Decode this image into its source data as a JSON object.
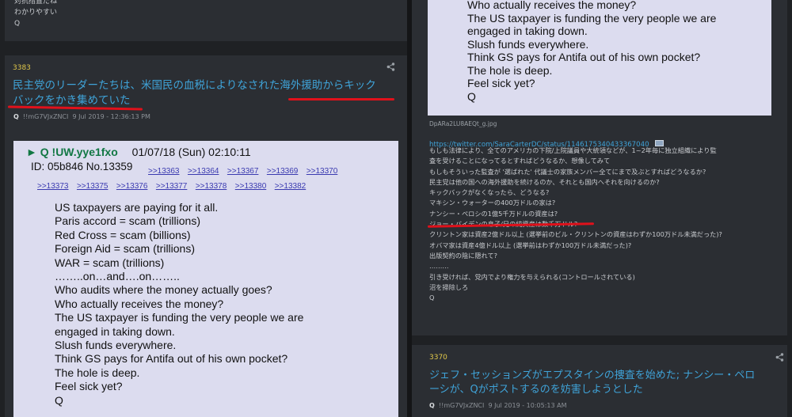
{
  "left": {
    "top_post_tail": [
      "対抗措置だね",
      "わかりやすい",
      "Q"
    ],
    "post": {
      "number": "3383",
      "title_line1": "民主党のリーダーたちは、米国民の血税によりなされた海外援助からキック",
      "title_line2": "バックをかき集めていた",
      "author": "Q",
      "trip": "!!mG7VJxZNCI",
      "date": "9 Jul 2019 - 12:36:13 PM",
      "quote": {
        "header": "► Q !UW.yye1fxo",
        "datetime": "01/07/18 (Sun) 02:10:11",
        "id_line": "ID: 05b846 No.13359",
        "replies_row1": [
          ">>13363",
          ">>13364",
          ">>13367",
          ">>13369",
          ">>13370"
        ],
        "replies_row2": [
          ">>13373",
          ">>13375",
          ">>13376",
          ">>13377",
          ">>13378",
          ">>13380",
          ">>13382"
        ],
        "lines": [
          "US taxpayers are paying for it all.",
          "Paris accord = scam (trillions)",
          "Red Cross = scam (billions)",
          "Foreign Aid = scam (trillions)",
          "WAR = scam (trillions)",
          "……..on…and….on……..",
          "Who audits where the money actually goes?",
          "Who actually receives the money?",
          "The US taxpayer is funding the very people we are",
          "engaged in taking down.",
          "Slush funds everywhere.",
          "Think GS pays for Antifa out of his own pocket?",
          "The hole is deep.",
          "Feel sick yet?",
          "Q"
        ]
      }
    }
  },
  "right": {
    "quote_tail": [
      "Who actually receives the money?",
      "The US taxpayer is funding the very people we are",
      "engaged in taking down.",
      "Slush funds everywhere.",
      "Think GS pays for Antifa out of his own pocket?",
      "The hole is deep.",
      "Feel sick yet?",
      "Q"
    ],
    "image_filename": "DpARa2LU8AEQt_g.jpg",
    "twitter_link": "https://twitter.com/SaraCarterDC/status/1146175340433367040",
    "body_lines": [
      "もしも法律により、全てのアメリカの下院/上院議員や大統領などが、1~2年毎に独立組織により監",
      "査を受けることになってるとすればどうなるか、想像してみて",
      "もしもそういった監査が '選ばれた' 代議士の家族メンバー全てにまで及ぶとすればどうなるか?",
      "民主党は他の国への海外援助を続けるのか、それとも国内へそれを向けるのか?",
      "キックバックがなくなったら、どうなる?",
      "マキシン・ウォーターの400万ドルの家は?",
      "ナンシー・ペロシの1億5千万ドルの資産は?",
      "ジョー・バイデンの息子/兄の純資産は数千万ドル?",
      "クリントン家は資産2億ドル以上 (選挙前のビル・クリントンの資産はわずか100万ドル未満だった)?",
      "オバマ家は資産4億ドル以上 (選挙前はわずか100万ドル未満だった)?",
      "出版契約の陰に隠れて?",
      "………",
      "引き受ければ、党内でより権力を与えられる(コントロールされている)",
      "沼を掃除しろ",
      "Q"
    ],
    "next_post": {
      "number": "3370",
      "title_line1": "ジェフ・セッションズがエプスタインの捜査を始めた; ナンシー・ペロ",
      "title_line2": "ーシが、Qがポストするのを妨害しようとした",
      "author": "Q",
      "trip": "!!mG7VJxZNCI",
      "date": "9 Jul 2019 - 10:05:13 AM"
    }
  },
  "colors": {
    "background": "#1f2124",
    "card": "#2b2e33",
    "post_number": "#e1c84a",
    "title_link": "#3fa3d8",
    "quote_bg": "#dcdcef",
    "underline_red": "#e0111b"
  },
  "icons": [
    "share-icon",
    "image-file-icon"
  ]
}
